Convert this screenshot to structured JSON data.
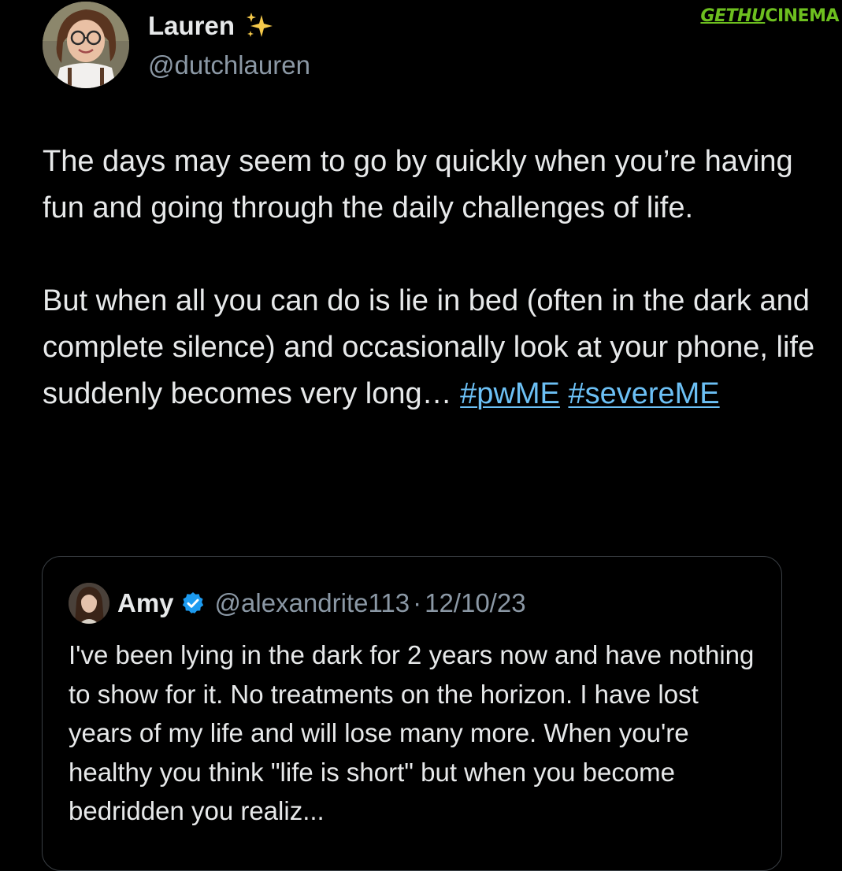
{
  "watermark": {
    "part1": "GETHU",
    "part2": "CINEMA"
  },
  "tweet": {
    "author": {
      "display_name": "Lauren",
      "emoji_icon": "sparkles-icon",
      "handle": "@dutchlauren"
    },
    "paragraph1": "The days may seem to go by quickly when you’re having fun and going through the daily challenges of life.",
    "paragraph2_text": "But when all you can do is lie in bed (often in the dark and complete silence) and occasionally look at your phone, life suddenly becomes very long…",
    "hashtags": [
      "#pwME",
      "#severeME"
    ],
    "link_color": "#6cc0f5"
  },
  "quoted_tweet": {
    "author": {
      "display_name": "Amy",
      "verified_icon": "verified-badge-icon",
      "handle": "@alexandrite113",
      "separator": "·",
      "date": "12/10/23"
    },
    "text": "I've been lying in the dark for 2 years now and have nothing to show for it. No treatments on the horizon. I have lost years of my life and will lose many more. When you're healthy you think \"life is short\" but when you become bedridden you realiz..."
  },
  "colors": {
    "background": "#000000",
    "text": "#e7e9ea",
    "secondary_text": "#8b98a5",
    "border": "#3a3f44",
    "verified_blue": "#1d9bf0"
  }
}
